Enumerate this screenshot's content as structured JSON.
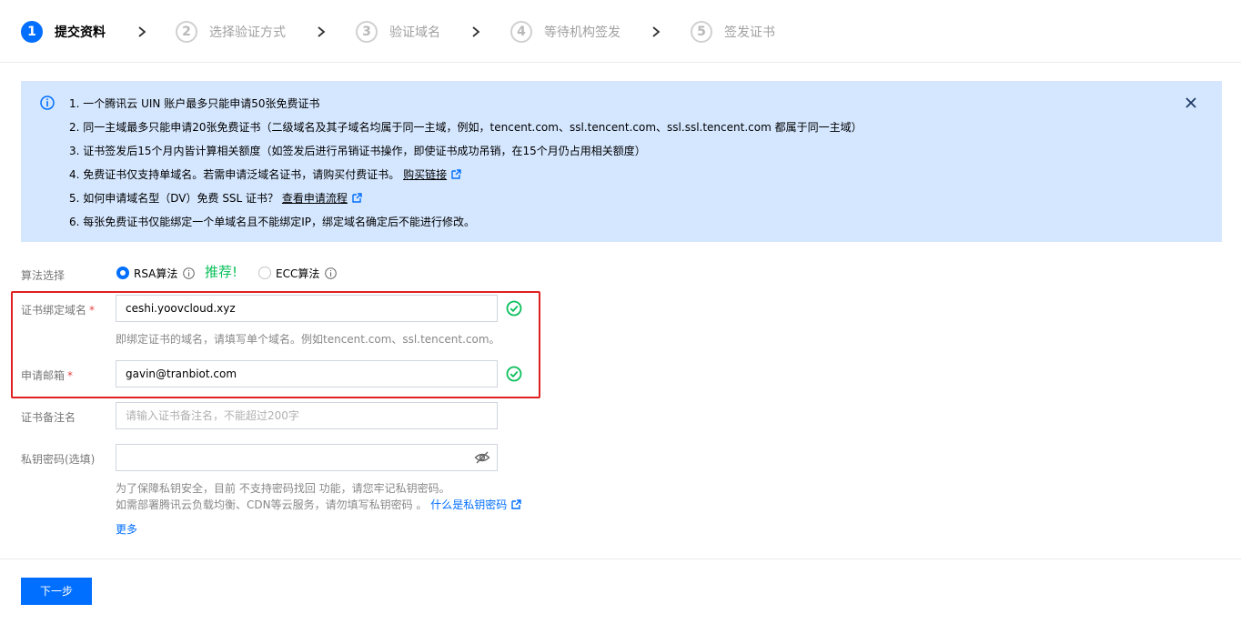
{
  "steps": [
    {
      "num": "1",
      "label": "提交资料",
      "active": true
    },
    {
      "num": "2",
      "label": "选择验证方式",
      "active": false
    },
    {
      "num": "3",
      "label": "验证域名",
      "active": false
    },
    {
      "num": "4",
      "label": "等待机构签发",
      "active": false
    },
    {
      "num": "5",
      "label": "签发证书",
      "active": false
    }
  ],
  "notice": {
    "line1": "1. 一个腾讯云 UIN 账户最多只能申请50张免费证书",
    "line2": "2. 同一主域最多只能申请20张免费证书（二级域名及其子域名均属于同一主域，例如，tencent.com、ssl.tencent.com、ssl.ssl.tencent.com 都属于同一主域）",
    "line3": "3. 证书签发后15个月内皆计算相关额度（如签发后进行吊销证书操作，即使证书成功吊销，在15个月仍占用相关额度）",
    "line4_text": "4. 免费证书仅支持单域名。若需申请泛域名证书，请购买付费证书。",
    "line4_link": "购买链接",
    "line5_text": "5. 如何申请域名型（DV）免费 SSL 证书？",
    "line5_link": "查看申请流程",
    "line6": "6. 每张免费证书仅能绑定一个单域名且不能绑定IP，绑定域名确定后不能进行修改。"
  },
  "form": {
    "algo_label": "算法选择",
    "rsa_label": "RSA算法",
    "recommend": "推荐!",
    "ecc_label": "ECC算法",
    "domain_label": "证书绑定域名",
    "domain_value": "ceshi.yoovcloud.xyz",
    "domain_hint": "即绑定证书的域名，请填写单个域名。例如tencent.com、ssl.tencent.com。",
    "email_label": "申请邮箱",
    "email_value": "gavin@tranbiot.com",
    "remark_label": "证书备注名",
    "remark_placeholder": "请输入证书备注名，不能超过200字",
    "key_label": "私钥密码(选填)",
    "key_hint1": "为了保障私钥安全，目前 不支持密码找回 功能，请您牢记私钥密码。",
    "key_hint2_text": "如需部署腾讯云负载均衡、CDN等云服务，请勿填写私钥密码 。",
    "key_hint2_link": "什么是私钥密码",
    "more": "更多",
    "required_mark": "*"
  },
  "next_button": "下一步",
  "colors": {
    "primary": "#006eff",
    "success": "#0abf5b",
    "notice_bg": "#d5e7ff",
    "highlight": "#e02020"
  }
}
